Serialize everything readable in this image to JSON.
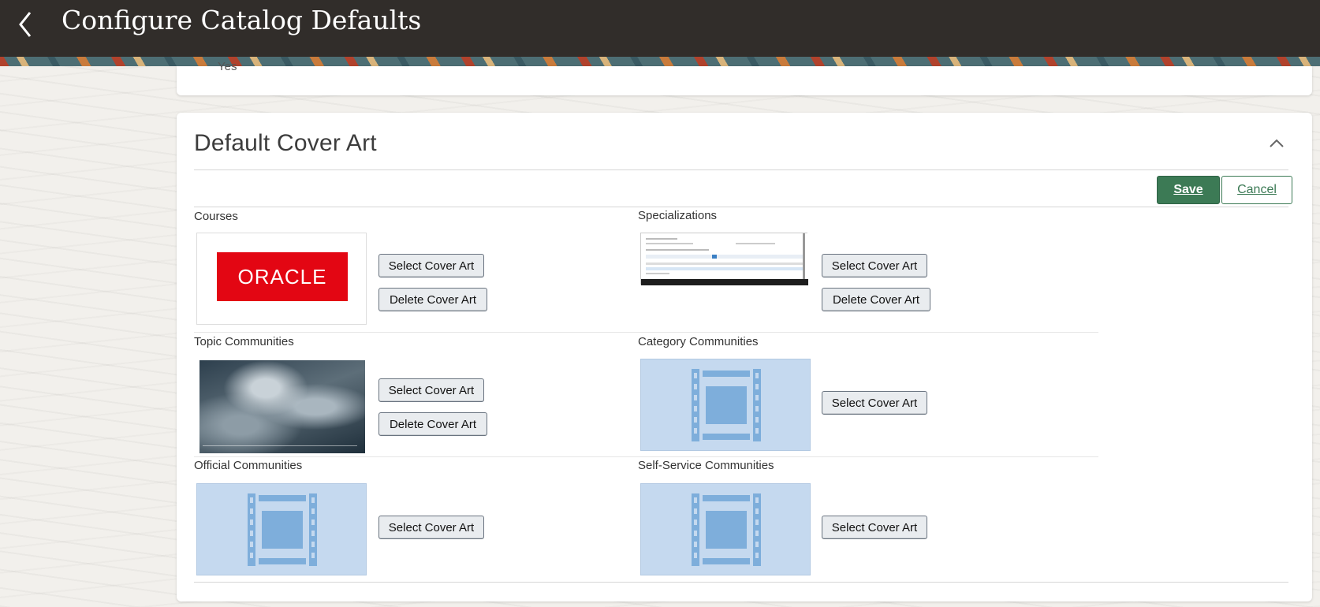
{
  "header": {
    "title": "Configure Catalog Defaults",
    "back_icon": "chevron-left-icon"
  },
  "prev_section": {
    "value": "Yes"
  },
  "cover_art": {
    "title": "Default Cover Art",
    "collapse_icon": "chevron-up-icon",
    "save_label": "Save",
    "cancel_label": "Cancel",
    "select_label": "Select Cover Art",
    "delete_label": "Delete Cover Art",
    "groups": {
      "courses": {
        "label": "Courses",
        "image": "ORACLE"
      },
      "specializations": {
        "label": "Specializations"
      },
      "topic_communities": {
        "label": "Topic Communities"
      },
      "category_communities": {
        "label": "Category Communities"
      },
      "official_communities": {
        "label": "Official Communities"
      },
      "self_service_communities": {
        "label": "Self-Service Communities"
      }
    }
  },
  "colors": {
    "header_bg": "#312d2a",
    "primary_button": "#3c7a55",
    "placeholder_bg": "#c5d9ef",
    "placeholder_icon": "#7eaedb",
    "oracle_red": "#e30613"
  }
}
